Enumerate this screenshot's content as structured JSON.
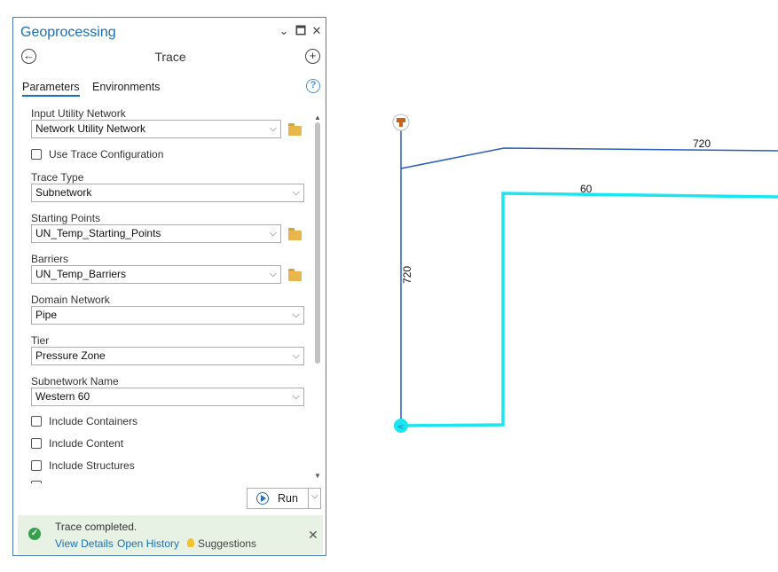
{
  "pane": {
    "title": "Geoprocessing",
    "tool_name": "Trace",
    "window_buttons": {
      "dropdown": "⌄",
      "maximize": "🗖",
      "close": "✕"
    },
    "tabs": [
      "Parameters",
      "Environments"
    ],
    "help_glyph": "?",
    "params": {
      "input_utility_network_label": "Input Utility Network",
      "input_utility_network_value": "Network Utility Network",
      "use_trace_config_label": "Use Trace Configuration",
      "trace_type_label": "Trace Type",
      "trace_type_value": "Subnetwork",
      "starting_points_label": "Starting Points",
      "starting_points_value": "UN_Temp_Starting_Points",
      "barriers_label": "Barriers",
      "barriers_value": "UN_Temp_Barriers",
      "domain_network_label": "Domain Network",
      "domain_network_value": "Pipe",
      "tier_label": "Tier",
      "tier_value": "Pressure Zone",
      "subnetwork_name_label": "Subnetwork Name",
      "subnetwork_name_value": "Western 60",
      "include_containers_label": "Include Containers",
      "include_content_label": "Include Content",
      "include_structures_label": "Include Structures"
    },
    "run_label": "Run",
    "message": {
      "status": "Trace completed.",
      "view_details": "View Details",
      "open_history": "Open History",
      "suggestions": "Suggestions"
    }
  },
  "map": {
    "labels": {
      "top_line": "720",
      "highlight_line": "60",
      "vertical_line": "720"
    },
    "colors": {
      "line": "#2a5cbf",
      "highlight": "#19e6f0",
      "device": "#c8641a"
    }
  }
}
